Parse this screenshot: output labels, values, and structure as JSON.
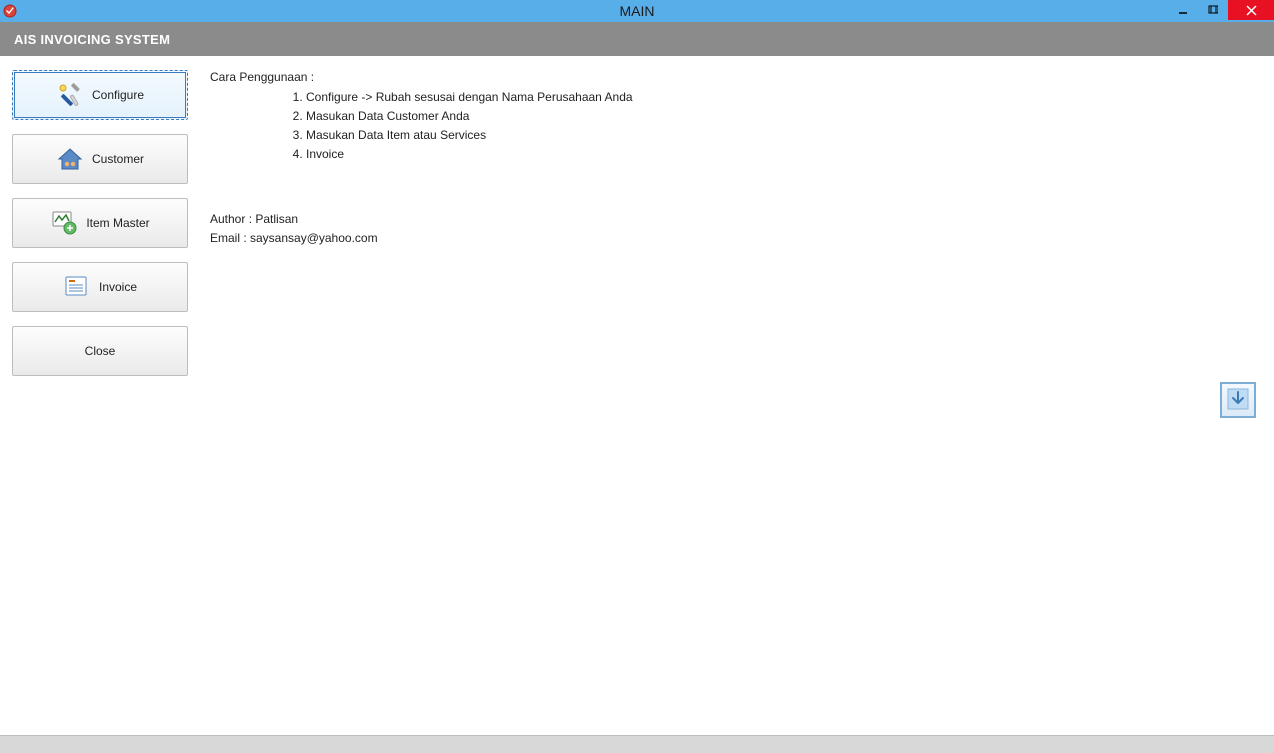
{
  "window": {
    "title": "MAIN"
  },
  "header": {
    "title": "AIS INVOICING SYSTEM"
  },
  "sidebar": {
    "configure": "Configure",
    "customer": "Customer",
    "item_master": "Item Master",
    "invoice": "Invoice",
    "close": "Close"
  },
  "content": {
    "heading": "Cara Penggunaan :",
    "steps": {
      "s1": "Configure -> Rubah sesusai dengan Nama Perusahaan Anda",
      "s2": "Masukan Data Customer Anda",
      "s3": "Masukan Data Item atau Services",
      "s4": "Invoice"
    },
    "author": "Author : Patlisan",
    "email": "Email : saysansay@yahoo.com"
  }
}
